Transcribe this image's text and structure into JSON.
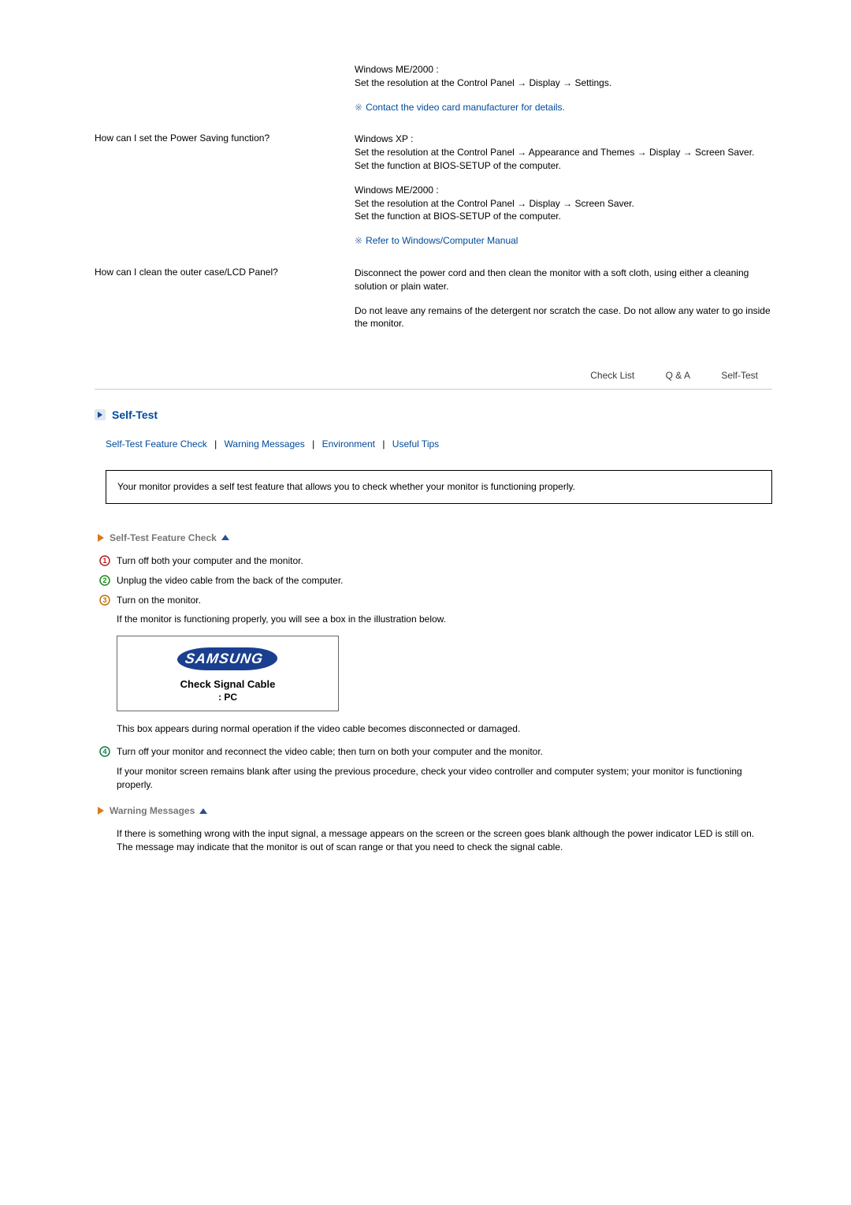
{
  "qa": {
    "row0": {
      "a_p1": "Windows ME/2000 :\nSet the resolution at the Control Panel → Display → Settings.",
      "note": "Contact the video card manufacturer for details."
    },
    "row1": {
      "q": "How can I set the Power Saving function?",
      "a_p1": "Windows XP :\nSet the resolution at the Control Panel → Appearance and Themes → Display → Screen Saver.\nSet the function at BIOS-SETUP of the computer.",
      "a_p2": "Windows ME/2000 :\nSet the resolution at the Control Panel → Display → Screen Saver.\nSet the function at BIOS-SETUP of the computer.",
      "note": "Refer to Windows/Computer Manual"
    },
    "row2": {
      "q": "How can I clean the outer case/LCD Panel?",
      "a_p1": "Disconnect the power cord and then clean the monitor with a soft cloth, using either a cleaning solution or plain water.",
      "a_p2": "Do not leave any remains of the detergent nor scratch the case. Do not allow any water to go inside the monitor."
    }
  },
  "tabs": {
    "checklist": "Check List",
    "qa": "Q  &  A",
    "selftest": "Self-Test"
  },
  "section_title": "Self-Test",
  "sublinks": {
    "a": "Self-Test Feature Check",
    "b": "Warning Messages",
    "c": "Environment",
    "d": "Useful Tips"
  },
  "intro": "Your monitor provides a self test feature that allows you to check whether your monitor is functioning properly.",
  "selftest": {
    "heading": "Self-Test Feature Check",
    "s1": "Turn off both your computer and the monitor.",
    "s2": "Unplug the video cable from the back of the computer.",
    "s3": "Turn on the monitor.",
    "s3b": "If the monitor is functioning properly, you will see a box in the illustration below.",
    "osd_brand": "SAMSUNG",
    "osd_msg": "Check Signal Cable",
    "osd_sub": ":    PC",
    "s3c": "This box appears during normal operation if the video cable becomes disconnected or damaged.",
    "s4": "Turn off your monitor and reconnect the video cable; then turn on both your computer and the monitor.",
    "s4b": "If your monitor screen remains blank after using the previous procedure, check your video controller and computer system; your monitor is functioning properly."
  },
  "warning": {
    "heading": "Warning Messages",
    "p1": "If there is something wrong with the input signal, a message appears on the screen or the screen goes blank although the power indicator LED is still on. The message may indicate that the monitor is out of scan range or that you need to check the signal cable."
  }
}
